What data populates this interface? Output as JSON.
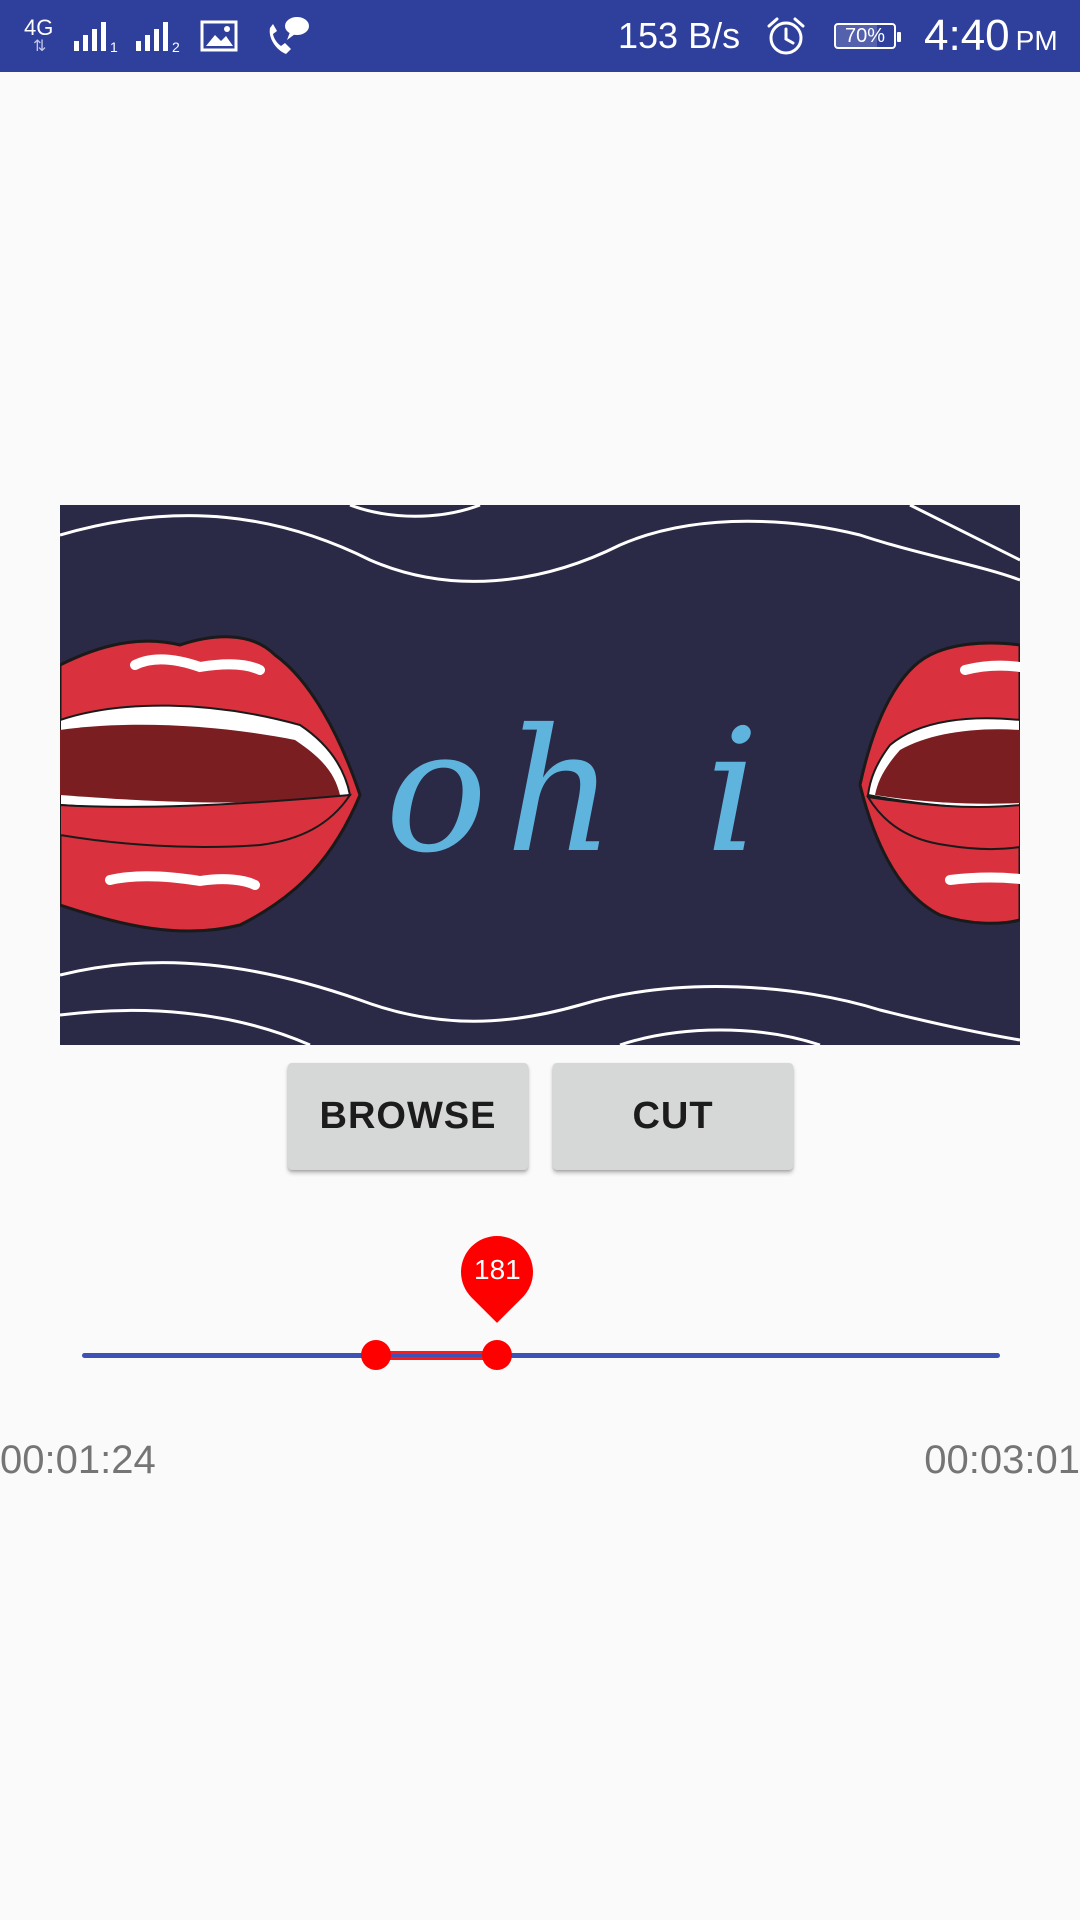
{
  "status_bar": {
    "network": "4G",
    "sim1_badge": "1",
    "sim2_badge": "2",
    "speed": "153 B/s",
    "battery_percent": 70,
    "battery": "70%",
    "time": "4:40",
    "ampm": "PM",
    "icons": [
      "network-4g-icon",
      "signal-sim1-icon",
      "signal-sim2-icon",
      "gallery-icon",
      "wifi-calling-icon",
      "alarm-icon",
      "battery-icon"
    ],
    "background_color": "#2f3f9c"
  },
  "video": {
    "overlay_text": "oh i"
  },
  "buttons": {
    "browse": "BROWSE",
    "cut": "CUT"
  },
  "range_slider": {
    "min": 0,
    "max": 400,
    "start": 128,
    "end": 181,
    "bubble_value": "181",
    "track_color": "#3f51b5",
    "accent_color": "#ff0000"
  },
  "times": {
    "start": "00:01:24",
    "end": "00:03:01"
  }
}
